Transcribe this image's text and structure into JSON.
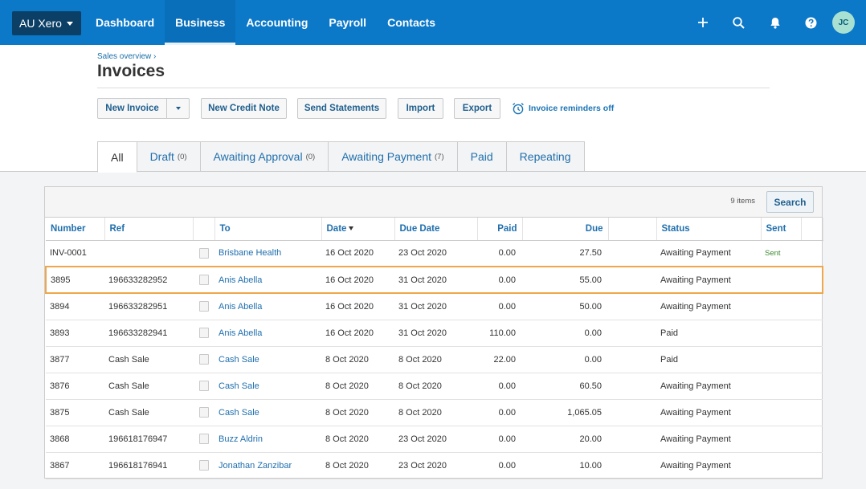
{
  "topnav": {
    "org": "AU Xero",
    "tabs": [
      "Dashboard",
      "Business",
      "Accounting",
      "Payroll",
      "Contacts"
    ],
    "active_tab": "Business",
    "avatar_initials": "JC",
    "icons": [
      "plus-icon",
      "search-icon",
      "bell-icon",
      "help-icon"
    ]
  },
  "header": {
    "breadcrumb": "Sales overview ›",
    "title": "Invoices"
  },
  "toolbar": {
    "new_invoice": "New Invoice",
    "new_credit_note": "New Credit Note",
    "send_statements": "Send Statements",
    "import": "Import",
    "export": "Export",
    "reminders": "Invoice reminders off"
  },
  "status_tabs": [
    {
      "label": "All",
      "count": ""
    },
    {
      "label": "Draft",
      "count": "(0)"
    },
    {
      "label": "Awaiting Approval",
      "count": "(0)"
    },
    {
      "label": "Awaiting Payment",
      "count": "(7)"
    },
    {
      "label": "Paid",
      "count": ""
    },
    {
      "label": "Repeating",
      "count": ""
    }
  ],
  "table": {
    "items_count": "9 items",
    "search_label": "Search",
    "columns": {
      "number": "Number",
      "ref": "Ref",
      "to": "To",
      "date": "Date",
      "due_date": "Due Date",
      "paid": "Paid",
      "due": "Due",
      "status": "Status",
      "sent": "Sent"
    },
    "rows": [
      {
        "number": "INV-0001",
        "ref": "",
        "to": "Brisbane Health",
        "date": "16 Oct 2020",
        "due_date": "23 Oct 2020",
        "paid": "0.00",
        "due": "27.50",
        "status": "Awaiting Payment",
        "sent": "Sent"
      },
      {
        "number": "3895",
        "ref": "196633282952",
        "to": "Anis Abella",
        "date": "16 Oct 2020",
        "due_date": "31 Oct 2020",
        "paid": "0.00",
        "due": "55.00",
        "status": "Awaiting Payment",
        "sent": ""
      },
      {
        "number": "3894",
        "ref": "196633282951",
        "to": "Anis Abella",
        "date": "16 Oct 2020",
        "due_date": "31 Oct 2020",
        "paid": "0.00",
        "due": "50.00",
        "status": "Awaiting Payment",
        "sent": ""
      },
      {
        "number": "3893",
        "ref": "196633282941",
        "to": "Anis Abella",
        "date": "16 Oct 2020",
        "due_date": "31 Oct 2020",
        "paid": "110.00",
        "due": "0.00",
        "status": "Paid",
        "sent": ""
      },
      {
        "number": "3877",
        "ref": "Cash Sale",
        "to": "Cash Sale",
        "date": "8 Oct 2020",
        "due_date": "8 Oct 2020",
        "paid": "22.00",
        "due": "0.00",
        "status": "Paid",
        "sent": ""
      },
      {
        "number": "3876",
        "ref": "Cash Sale",
        "to": "Cash Sale",
        "date": "8 Oct 2020",
        "due_date": "8 Oct 2020",
        "paid": "0.00",
        "due": "60.50",
        "status": "Awaiting Payment",
        "sent": ""
      },
      {
        "number": "3875",
        "ref": "Cash Sale",
        "to": "Cash Sale",
        "date": "8 Oct 2020",
        "due_date": "8 Oct 2020",
        "paid": "0.00",
        "due": "1,065.05",
        "status": "Awaiting Payment",
        "sent": ""
      },
      {
        "number": "3868",
        "ref": "196618176947",
        "to": "Buzz Aldrin",
        "date": "8 Oct 2020",
        "due_date": "23 Oct 2020",
        "paid": "0.00",
        "due": "20.00",
        "status": "Awaiting Payment",
        "sent": ""
      },
      {
        "number": "3867",
        "ref": "196618176941",
        "to": "Jonathan Zanzibar",
        "date": "8 Oct 2020",
        "due_date": "23 Oct 2020",
        "paid": "0.00",
        "due": "10.00",
        "status": "Awaiting Payment",
        "sent": ""
      }
    ]
  },
  "colors": {
    "brand_blue": "#0b78c8",
    "org_button": "#0b3f66",
    "link_blue": "#1f6fad",
    "highlight_outline": "#f0a64a",
    "sent_green": "#3c8a2e"
  }
}
